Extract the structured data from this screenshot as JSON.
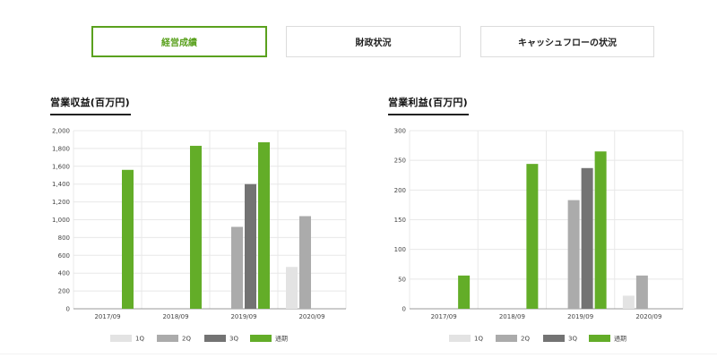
{
  "tabs": [
    {
      "label": "経営成績",
      "active": true
    },
    {
      "label": "財政状況",
      "active": false
    },
    {
      "label": "キャッシュフローの状況",
      "active": false
    }
  ],
  "colors": {
    "accent": "#5aa11e",
    "q1": "#e3e3e3",
    "q2": "#ababab",
    "q3": "#737373",
    "full_year": "#63ad28",
    "grid": "#e8e8e8",
    "axis": "#999999"
  },
  "chart_data": [
    {
      "type": "bar",
      "title": "営業収益(百万円)",
      "categories": [
        "2017/09",
        "2018/09",
        "2019/09",
        "2020/09"
      ],
      "ylim": [
        0,
        2000
      ],
      "yticks": [
        0,
        200,
        400,
        600,
        800,
        1000,
        1200,
        1400,
        1600,
        1800,
        2000
      ],
      "ytick_labels": [
        "0",
        "200",
        "400",
        "600",
        "800",
        "1,000",
        "1,200",
        "1,400",
        "1,600",
        "1,800",
        "2,000"
      ],
      "grid": true,
      "legend_position": "bottom",
      "series": [
        {
          "name": "1Q",
          "values": [
            null,
            null,
            null,
            470
          ]
        },
        {
          "name": "2Q",
          "values": [
            null,
            null,
            920,
            1040
          ]
        },
        {
          "name": "3Q",
          "values": [
            null,
            null,
            1400,
            null
          ]
        },
        {
          "name": "通期",
          "values": [
            1560,
            1830,
            1870,
            null
          ]
        }
      ]
    },
    {
      "type": "bar",
      "title": "営業利益(百万円)",
      "categories": [
        "2017/09",
        "2018/09",
        "2019/09",
        "2020/09"
      ],
      "ylim": [
        0,
        300
      ],
      "yticks": [
        0,
        50,
        100,
        150,
        200,
        250,
        300
      ],
      "ytick_labels": [
        "0",
        "50",
        "100",
        "150",
        "200",
        "250",
        "300"
      ],
      "grid": true,
      "legend_position": "bottom",
      "series": [
        {
          "name": "1Q",
          "values": [
            null,
            null,
            null,
            22
          ]
        },
        {
          "name": "2Q",
          "values": [
            null,
            null,
            183,
            56
          ]
        },
        {
          "name": "3Q",
          "values": [
            null,
            null,
            237,
            null
          ]
        },
        {
          "name": "通期",
          "values": [
            56,
            244,
            265,
            null
          ]
        }
      ]
    }
  ]
}
